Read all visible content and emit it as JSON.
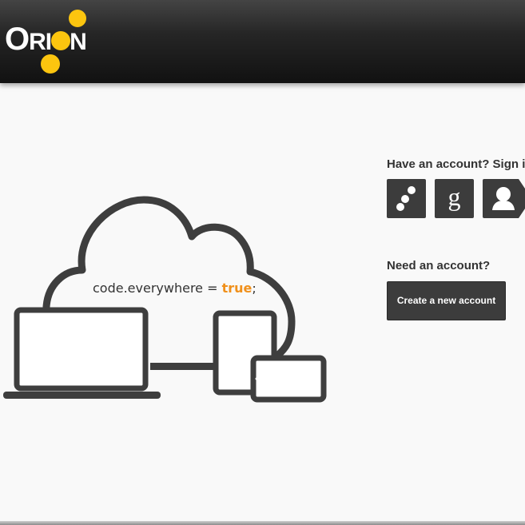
{
  "header": {
    "logo": {
      "text_o": "O",
      "text_rest": "RI",
      "text_n": "N",
      "dot_color": "#fcc50f"
    }
  },
  "illustration": {
    "code_prefix": "code.everywhere = ",
    "code_value": "true",
    "code_suffix": ";",
    "value_color": "#f0901b"
  },
  "signin": {
    "heading": "Have an account? Sign in",
    "providers": [
      {
        "name": "Orion",
        "icon": "orion-dots-icon"
      },
      {
        "name": "Google",
        "icon": "google-g-icon"
      },
      {
        "name": "Persona",
        "icon": "persona-person-icon"
      }
    ]
  },
  "register": {
    "heading": "Need an account?",
    "button_label": "Create a new account"
  }
}
